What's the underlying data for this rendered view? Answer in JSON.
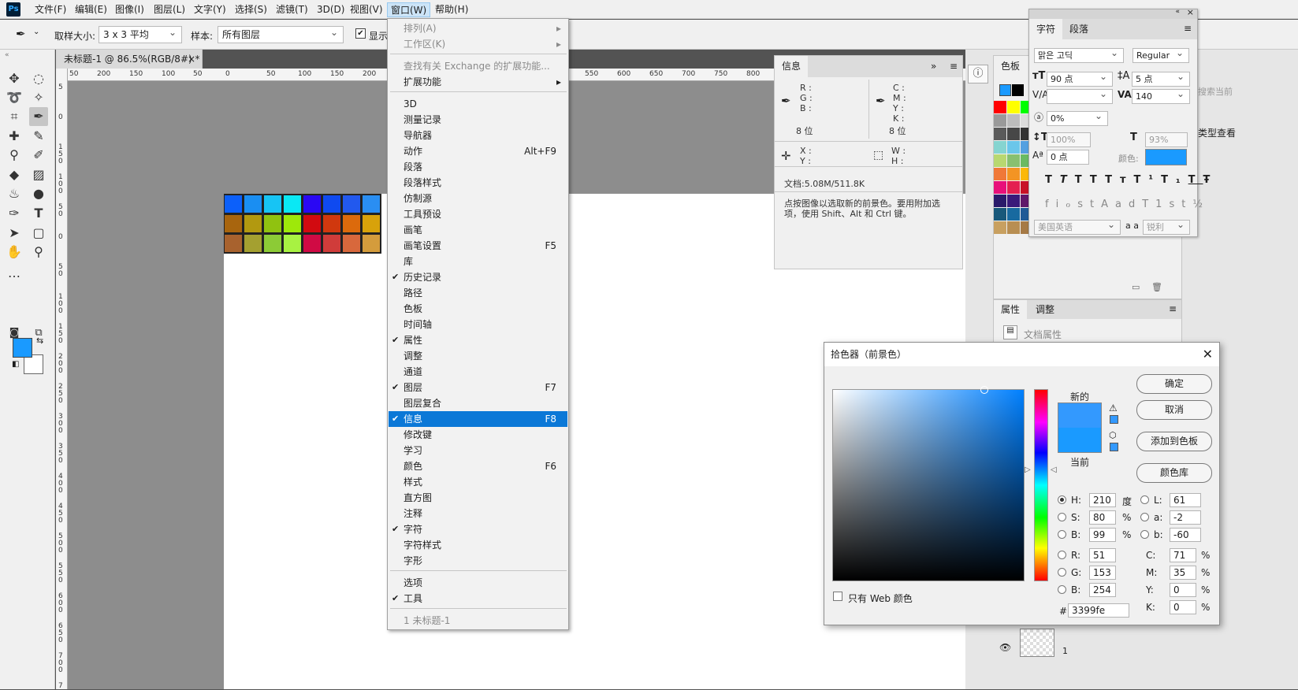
{
  "menubar": {
    "logo": "Ps",
    "items": [
      "文件(F)",
      "编辑(E)",
      "图像(I)",
      "图层(L)",
      "文字(Y)",
      "选择(S)",
      "滤镜(T)",
      "3D(D)",
      "视图(V)",
      "窗口(W)",
      "帮助(H)"
    ]
  },
  "options": {
    "sample_size_label": "取样大小:",
    "sample_size_value": "3 x 3 平均",
    "sample_label": "样本:",
    "sample_value": "所有图层",
    "show_ring_label": "显示"
  },
  "document": {
    "tab_title": "未标题-1 @ 86.5%(RGB/8#) *",
    "ruler_h": [
      "50",
      "200",
      "150",
      "100",
      "50",
      "0",
      "50",
      "100",
      "150",
      "200",
      "550",
      "600",
      "650",
      "700",
      "750",
      "800"
    ],
    "ruler_v": [
      "5",
      "0",
      "1 5 0",
      "1 0 0",
      "5 0",
      "0",
      "5 0",
      "1 0 0",
      "1 5 0",
      "2 0 0",
      "2 5 0",
      "3 0 0",
      "3 5 0",
      "4 0 0",
      "4 5 0",
      "5 0 0",
      "5 5 0",
      "6 0 0",
      "6 5 0",
      "7 0 0",
      "7"
    ],
    "swatch_rows": [
      [
        "#0c60fa",
        "#1a8ef2",
        "#17c4f4",
        "#0ae8f4",
        "#2a08f4",
        "#0f4af0",
        "#2259ee",
        "#2a8ef2"
      ],
      [
        "#a8650e",
        "#b29910",
        "#90c210",
        "#9ee80a",
        "#d20a10",
        "#d0380e",
        "#dc6a0c",
        "#d8a20a"
      ],
      [
        "#a8622e",
        "#a4a030",
        "#8ccb36",
        "#a8f242",
        "#d00a44",
        "#d03c3a",
        "#d8683c",
        "#d49c3c"
      ]
    ]
  },
  "window_menu": {
    "items": [
      {
        "label": "排列(A)",
        "shortcut": "",
        "disabled": true,
        "submenu": true,
        "checked": false
      },
      {
        "label": "工作区(K)",
        "shortcut": "",
        "disabled": true,
        "submenu": true,
        "checked": false
      },
      {
        "label": "查找有关 Exchange 的扩展功能...",
        "shortcut": "",
        "disabled": true,
        "submenu": false,
        "checked": false
      },
      {
        "label": "扩展功能",
        "shortcut": "",
        "disabled": false,
        "submenu": true,
        "checked": false
      },
      {
        "label": "3D",
        "shortcut": "",
        "disabled": false,
        "submenu": false,
        "checked": false
      },
      {
        "label": "测量记录",
        "shortcut": "",
        "disabled": false,
        "submenu": false,
        "checked": false
      },
      {
        "label": "导航器",
        "shortcut": "",
        "disabled": false,
        "submenu": false,
        "checked": false
      },
      {
        "label": "动作",
        "shortcut": "Alt+F9",
        "disabled": false,
        "submenu": false,
        "checked": false
      },
      {
        "label": "段落",
        "shortcut": "",
        "disabled": false,
        "submenu": false,
        "checked": false
      },
      {
        "label": "段落样式",
        "shortcut": "",
        "disabled": false,
        "submenu": false,
        "checked": false
      },
      {
        "label": "仿制源",
        "shortcut": "",
        "disabled": false,
        "submenu": false,
        "checked": false
      },
      {
        "label": "工具预设",
        "shortcut": "",
        "disabled": false,
        "submenu": false,
        "checked": false
      },
      {
        "label": "画笔",
        "shortcut": "",
        "disabled": false,
        "submenu": false,
        "checked": false
      },
      {
        "label": "画笔设置",
        "shortcut": "F5",
        "disabled": false,
        "submenu": false,
        "checked": false
      },
      {
        "label": "库",
        "shortcut": "",
        "disabled": false,
        "submenu": false,
        "checked": false
      },
      {
        "label": "历史记录",
        "shortcut": "",
        "disabled": false,
        "submenu": false,
        "checked": true
      },
      {
        "label": "路径",
        "shortcut": "",
        "disabled": false,
        "submenu": false,
        "checked": false
      },
      {
        "label": "色板",
        "shortcut": "",
        "disabled": false,
        "submenu": false,
        "checked": false
      },
      {
        "label": "时间轴",
        "shortcut": "",
        "disabled": false,
        "submenu": false,
        "checked": false
      },
      {
        "label": "属性",
        "shortcut": "",
        "disabled": false,
        "submenu": false,
        "checked": true
      },
      {
        "label": "调整",
        "shortcut": "",
        "disabled": false,
        "submenu": false,
        "checked": false
      },
      {
        "label": "通道",
        "shortcut": "",
        "disabled": false,
        "submenu": false,
        "checked": false
      },
      {
        "label": "图层",
        "shortcut": "F7",
        "disabled": false,
        "submenu": false,
        "checked": true
      },
      {
        "label": "图层复合",
        "shortcut": "",
        "disabled": false,
        "submenu": false,
        "checked": false
      },
      {
        "label": "信息",
        "shortcut": "F8",
        "disabled": false,
        "submenu": false,
        "checked": true,
        "highlighted": true
      },
      {
        "label": "修改键",
        "shortcut": "",
        "disabled": false,
        "submenu": false,
        "checked": false
      },
      {
        "label": "学习",
        "shortcut": "",
        "disabled": false,
        "submenu": false,
        "checked": false
      },
      {
        "label": "颜色",
        "shortcut": "F6",
        "disabled": false,
        "submenu": false,
        "checked": false
      },
      {
        "label": "样式",
        "shortcut": "",
        "disabled": false,
        "submenu": false,
        "checked": false
      },
      {
        "label": "直方图",
        "shortcut": "",
        "disabled": false,
        "submenu": false,
        "checked": false
      },
      {
        "label": "注释",
        "shortcut": "",
        "disabled": false,
        "submenu": false,
        "checked": false
      },
      {
        "label": "字符",
        "shortcut": "",
        "disabled": false,
        "submenu": false,
        "checked": true
      },
      {
        "label": "字符样式",
        "shortcut": "",
        "disabled": false,
        "submenu": false,
        "checked": false
      },
      {
        "label": "字形",
        "shortcut": "",
        "disabled": false,
        "submenu": false,
        "checked": false
      },
      {
        "label": "选项",
        "shortcut": "",
        "disabled": false,
        "submenu": false,
        "checked": false
      },
      {
        "label": "工具",
        "shortcut": "",
        "disabled": false,
        "submenu": false,
        "checked": true
      },
      {
        "label": "1 未标题-1",
        "shortcut": "",
        "disabled": true,
        "submenu": false,
        "checked": false
      }
    ]
  },
  "info_panel": {
    "tab": "信息",
    "rgb_labels": "R :\nG :\nB :",
    "cmyk_labels": "C :\nM :\nY :\nK :",
    "bits_left": "8 位",
    "bits_right": "8 位",
    "xy_labels": "X :\nY :",
    "wh_labels": "W :\nH :",
    "doc": "文档:5.08M/511.8K",
    "hint": "点按图像以选取新的前景色。要用附加选项，使用 Shift、Alt 和 Ctrl 键。"
  },
  "swatches_panel": {
    "tab": "色板",
    "colors": [
      [
        "#ff0000",
        "#ffff00",
        "#00ff00"
      ],
      [
        "#9a9a9a",
        "#bdbdbd",
        "#dcdcdc"
      ],
      [
        "#5a5a5a",
        "#474747",
        "#333333"
      ],
      [
        "#85d4d0",
        "#6ac6ea",
        "#55a0e0"
      ],
      [
        "#b8d870",
        "#88c070",
        "#6aba62"
      ],
      [
        "#f07838",
        "#f39424",
        "#fbb808"
      ],
      [
        "#e8107a",
        "#e42050",
        "#c81226"
      ],
      [
        "#2a1a6a",
        "#3a1a7a",
        "#60186a"
      ],
      [
        "#18587a",
        "#186aa0",
        "#205a96"
      ],
      [
        "#c8a060",
        "#b88e52",
        "#a67a46"
      ]
    ]
  },
  "properties_panel": {
    "tabs": [
      "属性",
      "调整"
    ],
    "doc_label": "文档属性"
  },
  "char_panel": {
    "tabs": [
      "字符",
      "段落"
    ],
    "font": "맑은 고딕",
    "style": "Regular",
    "size": "90 点",
    "leading": "5 点",
    "kerning": "",
    "tracking": "140",
    "scale_pct": "0%",
    "v_scale": "100%",
    "h_scale": "93%",
    "baseline": "0 点",
    "color_label": "颜色:",
    "styles": [
      "T",
      "T",
      "TT",
      "Tт",
      "T¹",
      "T₁",
      "T",
      "Ŧ"
    ],
    "opentype": [
      "fi",
      "ℴ",
      "st",
      "A",
      "ad",
      "T",
      "1st",
      "½"
    ],
    "lang": "美国英语",
    "aa_label": "a a",
    "aa": "锐利",
    "right_hint": "搜索当前",
    "right_label": "类型查看"
  },
  "color_picker": {
    "title": "拾色器（前景色）",
    "new_label": "新的",
    "current_label": "当前",
    "buttons": {
      "ok": "确定",
      "cancel": "取消",
      "add": "添加到色板",
      "lib": "颜色库"
    },
    "web_only": "只有 Web 颜色",
    "hex": "3399fe",
    "hash": "#",
    "H": "210",
    "S": "80",
    "Bv": "99",
    "R": "51",
    "G": "153",
    "B": "254",
    "L": "61",
    "a": "-2",
    "b": "-60",
    "C": "71",
    "M": "35",
    "Y": "0",
    "K": "0",
    "units": {
      "deg": "度",
      "pct": "%"
    },
    "labels": {
      "H": "H:",
      "S": "S:",
      "Bv": "B:",
      "R": "R:",
      "G": "G:",
      "B": "B:",
      "L": "L:",
      "a": "a:",
      "b": "b:",
      "C": "C:",
      "M": "M:",
      "Y": "Y:",
      "K": "K:"
    },
    "new_color": "#3399fe",
    "current_color": "#1a9aff"
  },
  "layers_row": {
    "name": "1"
  }
}
